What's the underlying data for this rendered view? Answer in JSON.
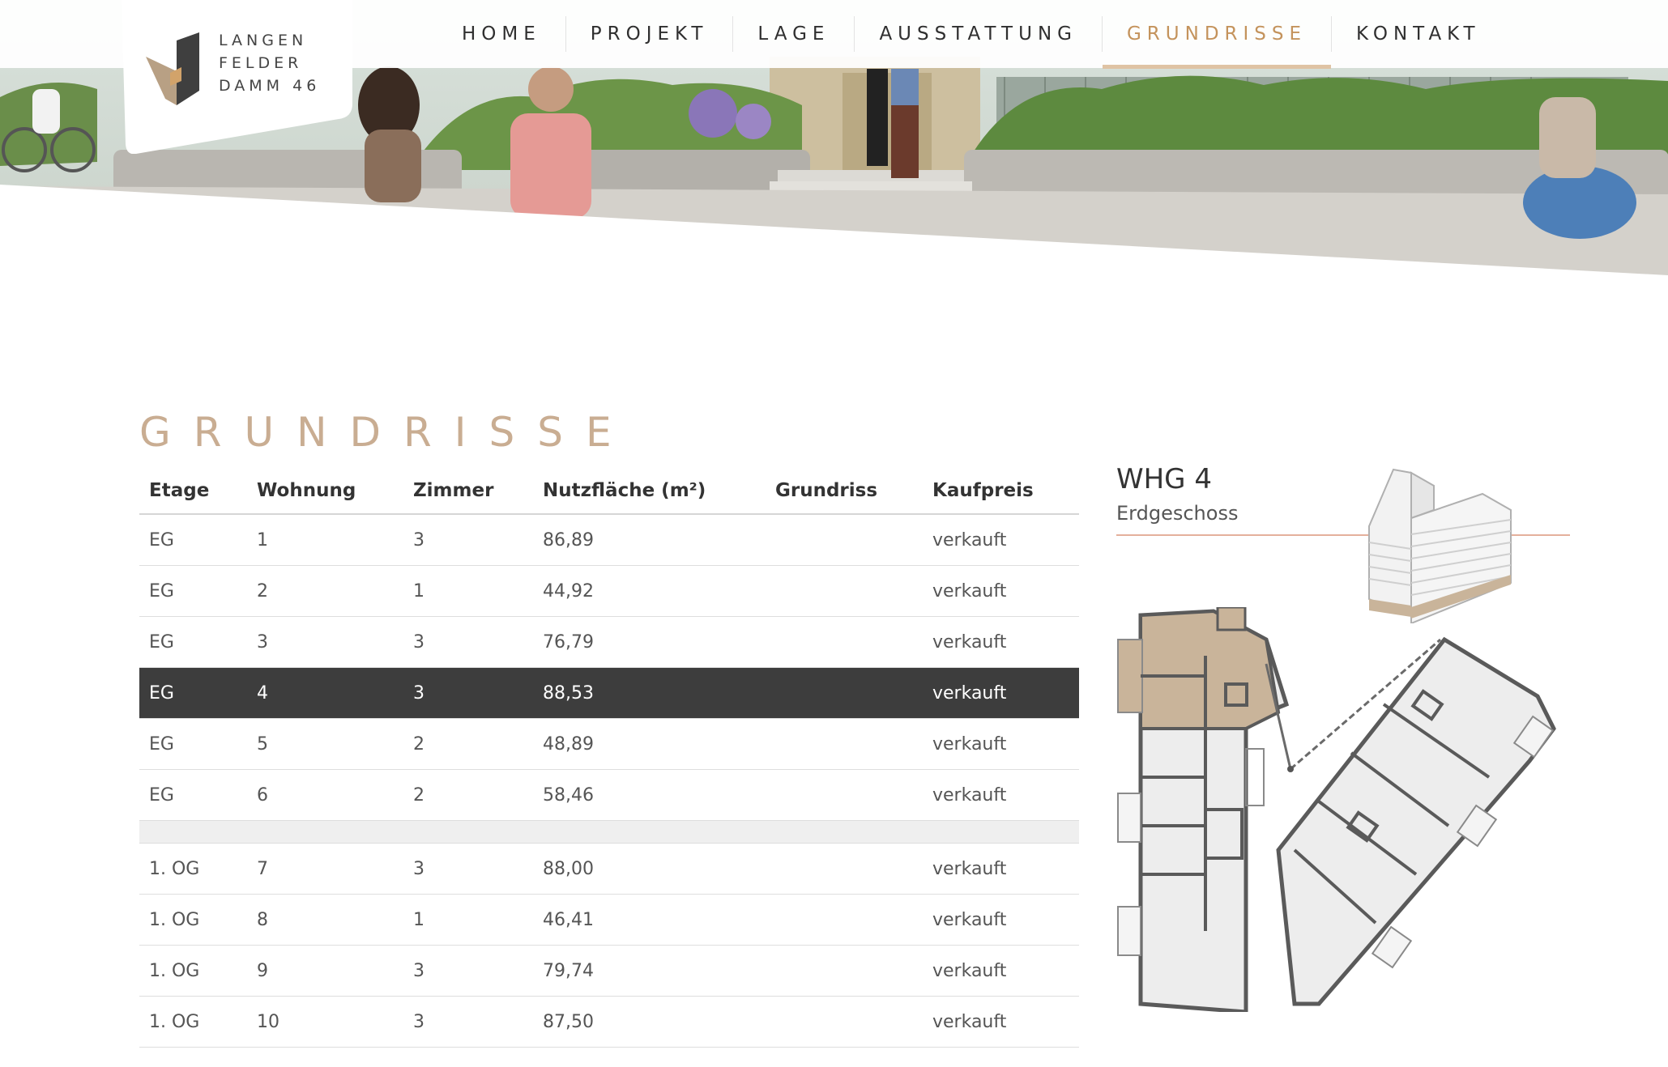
{
  "brand": {
    "lines": [
      "LANGEN",
      "FELDER",
      "DAMM 46"
    ],
    "accent_color": "#c4935c",
    "mark_colors": [
      "#b8a084",
      "#3f3f3f"
    ]
  },
  "nav": {
    "items": [
      {
        "label": "HOME",
        "active": false
      },
      {
        "label": "PROJEKT",
        "active": false
      },
      {
        "label": "LAGE",
        "active": false
      },
      {
        "label": "AUSSTATTUNG",
        "active": false
      },
      {
        "label": "GRUNDRISSE",
        "active": true
      },
      {
        "label": "KONTAKT",
        "active": false
      }
    ]
  },
  "page": {
    "title": "GRUNDRISSE"
  },
  "table": {
    "headers": [
      "Etage",
      "Wohnung",
      "Zimmer",
      "Nutzfläche (m²)",
      "Grundriss",
      "Kaufpreis"
    ],
    "rows": [
      {
        "etage": "EG",
        "wohnung": "1",
        "zimmer": "3",
        "flaeche": "86,89",
        "grundriss": "",
        "preis": "verkauft"
      },
      {
        "etage": "EG",
        "wohnung": "2",
        "zimmer": "1",
        "flaeche": "44,92",
        "grundriss": "",
        "preis": "verkauft"
      },
      {
        "etage": "EG",
        "wohnung": "3",
        "zimmer": "3",
        "flaeche": "76,79",
        "grundriss": "",
        "preis": "verkauft"
      },
      {
        "etage": "EG",
        "wohnung": "4",
        "zimmer": "3",
        "flaeche": "88,53",
        "grundriss": "",
        "preis": "verkauft"
      },
      {
        "etage": "EG",
        "wohnung": "5",
        "zimmer": "2",
        "flaeche": "48,89",
        "grundriss": "",
        "preis": "verkauft"
      },
      {
        "etage": "EG",
        "wohnung": "6",
        "zimmer": "2",
        "flaeche": "58,46",
        "grundriss": "",
        "preis": "verkauft"
      },
      {
        "etage": "1. OG",
        "wohnung": "7",
        "zimmer": "3",
        "flaeche": "88,00",
        "grundriss": "",
        "preis": "verkauft"
      },
      {
        "etage": "1. OG",
        "wohnung": "8",
        "zimmer": "1",
        "flaeche": "46,41",
        "grundriss": "",
        "preis": "verkauft"
      },
      {
        "etage": "1. OG",
        "wohnung": "9",
        "zimmer": "3",
        "flaeche": "79,74",
        "grundriss": "",
        "preis": "verkauft"
      },
      {
        "etage": "1. OG",
        "wohnung": "10",
        "zimmer": "3",
        "flaeche": "87,50",
        "grundriss": "",
        "preis": "verkauft"
      }
    ],
    "selected_index": 3
  },
  "detail": {
    "title": "WHG 4",
    "subtitle": "Erdgeschoss",
    "highlight_color": "#c9b49a"
  }
}
